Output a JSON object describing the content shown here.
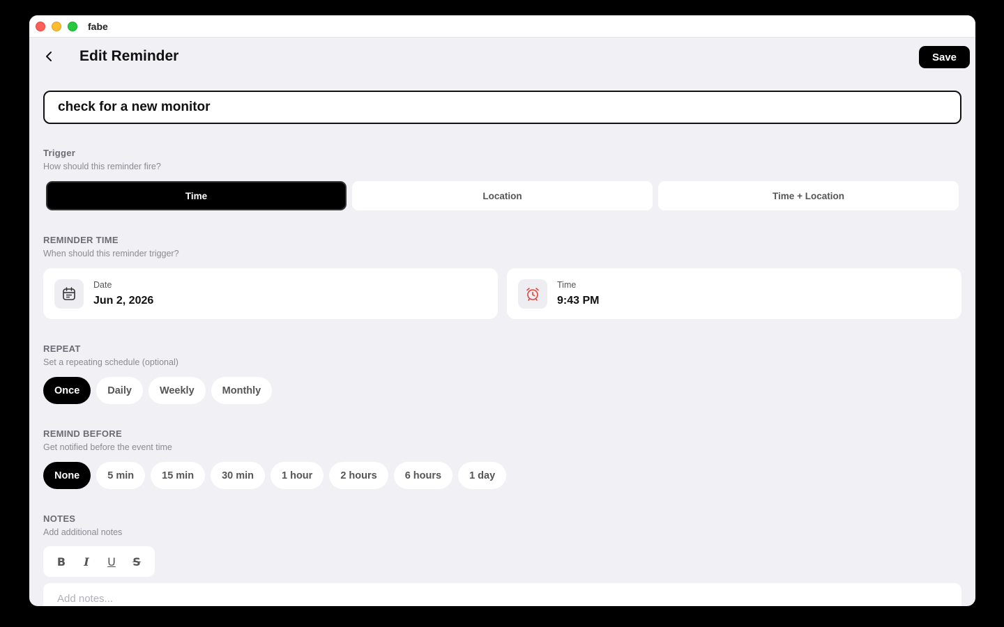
{
  "window": {
    "app_title": "fabe"
  },
  "header": {
    "title": "Edit Reminder",
    "save_label": "Save"
  },
  "reminder": {
    "title": "check for a new monitor"
  },
  "trigger": {
    "label": "Trigger",
    "subtitle": "How should this reminder fire?",
    "options": [
      "Time",
      "Location",
      "Time + Location"
    ],
    "selected": "Time"
  },
  "reminder_time": {
    "label": "REMINDER TIME",
    "subtitle": "When should this reminder trigger?",
    "date_label": "Date",
    "date_value": "Jun 2, 2026",
    "time_label": "Time",
    "time_value": "9:43 PM",
    "date_icon": "calendar-icon",
    "time_icon": "alarm-clock-icon",
    "alarm_color": "#e0463a"
  },
  "repeat": {
    "label": "REPEAT",
    "subtitle": "Set a repeating schedule (optional)",
    "options": [
      "Once",
      "Daily",
      "Weekly",
      "Monthly"
    ],
    "selected": "Once"
  },
  "remind_before": {
    "label": "REMIND BEFORE",
    "subtitle": "Get notified before the event time",
    "options": [
      "None",
      "5 min",
      "15 min",
      "30 min",
      "1 hour",
      "2 hours",
      "6 hours",
      "1 day"
    ],
    "selected": "None"
  },
  "notes": {
    "label": "NOTES",
    "subtitle": "Add additional notes",
    "placeholder": "Add notes...",
    "format_buttons": [
      "B",
      "I",
      "U",
      "S"
    ]
  }
}
